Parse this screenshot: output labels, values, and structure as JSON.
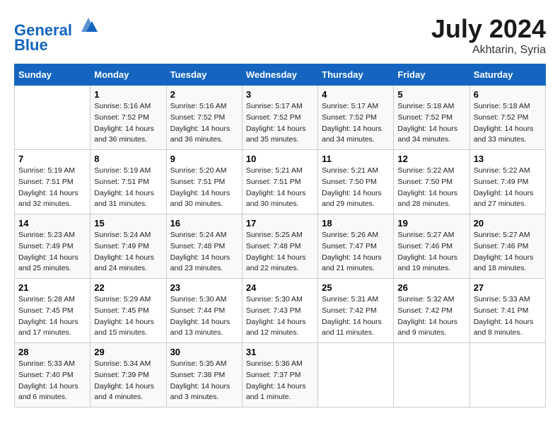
{
  "header": {
    "logo_line1": "General",
    "logo_line2": "Blue",
    "title": "July 2024",
    "subtitle": "Akhtarin, Syria"
  },
  "columns": [
    "Sunday",
    "Monday",
    "Tuesday",
    "Wednesday",
    "Thursday",
    "Friday",
    "Saturday"
  ],
  "weeks": [
    [
      {
        "day": "",
        "sunrise": "",
        "sunset": "",
        "daylight": ""
      },
      {
        "day": "1",
        "sunrise": "Sunrise: 5:16 AM",
        "sunset": "Sunset: 7:52 PM",
        "daylight": "Daylight: 14 hours and 36 minutes."
      },
      {
        "day": "2",
        "sunrise": "Sunrise: 5:16 AM",
        "sunset": "Sunset: 7:52 PM",
        "daylight": "Daylight: 14 hours and 36 minutes."
      },
      {
        "day": "3",
        "sunrise": "Sunrise: 5:17 AM",
        "sunset": "Sunset: 7:52 PM",
        "daylight": "Daylight: 14 hours and 35 minutes."
      },
      {
        "day": "4",
        "sunrise": "Sunrise: 5:17 AM",
        "sunset": "Sunset: 7:52 PM",
        "daylight": "Daylight: 14 hours and 34 minutes."
      },
      {
        "day": "5",
        "sunrise": "Sunrise: 5:18 AM",
        "sunset": "Sunset: 7:52 PM",
        "daylight": "Daylight: 14 hours and 34 minutes."
      },
      {
        "day": "6",
        "sunrise": "Sunrise: 5:18 AM",
        "sunset": "Sunset: 7:52 PM",
        "daylight": "Daylight: 14 hours and 33 minutes."
      }
    ],
    [
      {
        "day": "7",
        "sunrise": "Sunrise: 5:19 AM",
        "sunset": "Sunset: 7:51 PM",
        "daylight": "Daylight: 14 hours and 32 minutes."
      },
      {
        "day": "8",
        "sunrise": "Sunrise: 5:19 AM",
        "sunset": "Sunset: 7:51 PM",
        "daylight": "Daylight: 14 hours and 31 minutes."
      },
      {
        "day": "9",
        "sunrise": "Sunrise: 5:20 AM",
        "sunset": "Sunset: 7:51 PM",
        "daylight": "Daylight: 14 hours and 30 minutes."
      },
      {
        "day": "10",
        "sunrise": "Sunrise: 5:21 AM",
        "sunset": "Sunset: 7:51 PM",
        "daylight": "Daylight: 14 hours and 30 minutes."
      },
      {
        "day": "11",
        "sunrise": "Sunrise: 5:21 AM",
        "sunset": "Sunset: 7:50 PM",
        "daylight": "Daylight: 14 hours and 29 minutes."
      },
      {
        "day": "12",
        "sunrise": "Sunrise: 5:22 AM",
        "sunset": "Sunset: 7:50 PM",
        "daylight": "Daylight: 14 hours and 28 minutes."
      },
      {
        "day": "13",
        "sunrise": "Sunrise: 5:22 AM",
        "sunset": "Sunset: 7:49 PM",
        "daylight": "Daylight: 14 hours and 27 minutes."
      }
    ],
    [
      {
        "day": "14",
        "sunrise": "Sunrise: 5:23 AM",
        "sunset": "Sunset: 7:49 PM",
        "daylight": "Daylight: 14 hours and 25 minutes."
      },
      {
        "day": "15",
        "sunrise": "Sunrise: 5:24 AM",
        "sunset": "Sunset: 7:49 PM",
        "daylight": "Daylight: 14 hours and 24 minutes."
      },
      {
        "day": "16",
        "sunrise": "Sunrise: 5:24 AM",
        "sunset": "Sunset: 7:48 PM",
        "daylight": "Daylight: 14 hours and 23 minutes."
      },
      {
        "day": "17",
        "sunrise": "Sunrise: 5:25 AM",
        "sunset": "Sunset: 7:48 PM",
        "daylight": "Daylight: 14 hours and 22 minutes."
      },
      {
        "day": "18",
        "sunrise": "Sunrise: 5:26 AM",
        "sunset": "Sunset: 7:47 PM",
        "daylight": "Daylight: 14 hours and 21 minutes."
      },
      {
        "day": "19",
        "sunrise": "Sunrise: 5:27 AM",
        "sunset": "Sunset: 7:46 PM",
        "daylight": "Daylight: 14 hours and 19 minutes."
      },
      {
        "day": "20",
        "sunrise": "Sunrise: 5:27 AM",
        "sunset": "Sunset: 7:46 PM",
        "daylight": "Daylight: 14 hours and 18 minutes."
      }
    ],
    [
      {
        "day": "21",
        "sunrise": "Sunrise: 5:28 AM",
        "sunset": "Sunset: 7:45 PM",
        "daylight": "Daylight: 14 hours and 17 minutes."
      },
      {
        "day": "22",
        "sunrise": "Sunrise: 5:29 AM",
        "sunset": "Sunset: 7:45 PM",
        "daylight": "Daylight: 14 hours and 15 minutes."
      },
      {
        "day": "23",
        "sunrise": "Sunrise: 5:30 AM",
        "sunset": "Sunset: 7:44 PM",
        "daylight": "Daylight: 14 hours and 13 minutes."
      },
      {
        "day": "24",
        "sunrise": "Sunrise: 5:30 AM",
        "sunset": "Sunset: 7:43 PM",
        "daylight": "Daylight: 14 hours and 12 minutes."
      },
      {
        "day": "25",
        "sunrise": "Sunrise: 5:31 AM",
        "sunset": "Sunset: 7:42 PM",
        "daylight": "Daylight: 14 hours and 11 minutes."
      },
      {
        "day": "26",
        "sunrise": "Sunrise: 5:32 AM",
        "sunset": "Sunset: 7:42 PM",
        "daylight": "Daylight: 14 hours and 9 minutes."
      },
      {
        "day": "27",
        "sunrise": "Sunrise: 5:33 AM",
        "sunset": "Sunset: 7:41 PM",
        "daylight": "Daylight: 14 hours and 8 minutes."
      }
    ],
    [
      {
        "day": "28",
        "sunrise": "Sunrise: 5:33 AM",
        "sunset": "Sunset: 7:40 PM",
        "daylight": "Daylight: 14 hours and 6 minutes."
      },
      {
        "day": "29",
        "sunrise": "Sunrise: 5:34 AM",
        "sunset": "Sunset: 7:39 PM",
        "daylight": "Daylight: 14 hours and 4 minutes."
      },
      {
        "day": "30",
        "sunrise": "Sunrise: 5:35 AM",
        "sunset": "Sunset: 7:38 PM",
        "daylight": "Daylight: 14 hours and 3 minutes."
      },
      {
        "day": "31",
        "sunrise": "Sunrise: 5:36 AM",
        "sunset": "Sunset: 7:37 PM",
        "daylight": "Daylight: 14 hours and 1 minute."
      },
      {
        "day": "",
        "sunrise": "",
        "sunset": "",
        "daylight": ""
      },
      {
        "day": "",
        "sunrise": "",
        "sunset": "",
        "daylight": ""
      },
      {
        "day": "",
        "sunrise": "",
        "sunset": "",
        "daylight": ""
      }
    ]
  ]
}
